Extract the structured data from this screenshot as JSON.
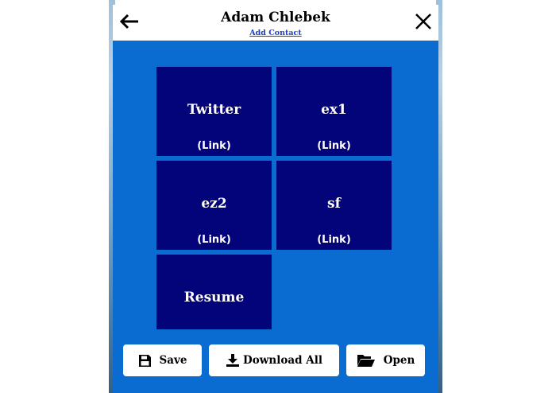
{
  "header": {
    "title": "Adam Chlebek",
    "add_contact_label": "Add Contact",
    "back_icon": "arrow-left-icon",
    "close_icon": "close-icon"
  },
  "tiles": [
    {
      "name": "Twitter",
      "link_label": "(Link)"
    },
    {
      "name": "ex1",
      "link_label": "(Link)"
    },
    {
      "name": "ez2",
      "link_label": "(Link)"
    },
    {
      "name": "sf",
      "link_label": "(Link)"
    },
    {
      "name": "Resume"
    }
  ],
  "toolbar": {
    "save_label": "Save",
    "download_all_label": "Download All",
    "open_label": "Open",
    "save_icon": "floppy-disk-icon",
    "download_icon": "download-icon",
    "open_icon": "folder-open-icon"
  },
  "colors": {
    "app_background": "#0a6bd1",
    "tile_background": "#03037a",
    "header_background": "#ffffff"
  }
}
